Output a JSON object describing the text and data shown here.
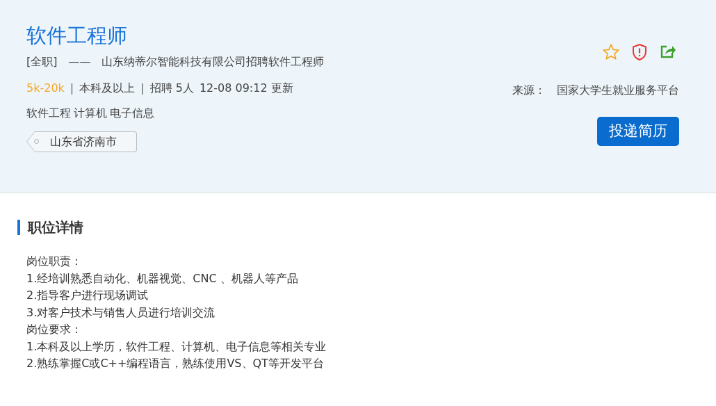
{
  "job": {
    "title": "软件工程师",
    "type": "[全职]",
    "dash": "——",
    "headline": "山东纳蒂尔智能科技有限公司招聘软件工程师",
    "meta": [
      {
        "kind": "salary",
        "text": "5k-20k"
      },
      {
        "kind": "divider",
        "text": "|"
      },
      {
        "kind": "plain",
        "text": "本科及以上"
      },
      {
        "kind": "divider",
        "text": "|"
      },
      {
        "kind": "plain",
        "text": "招聘 5人"
      },
      {
        "kind": "plain",
        "text": "12-08 09:12 更新"
      }
    ],
    "majors": [
      "软件工程",
      "计算机",
      "电子信息"
    ],
    "location": "山东省济南市"
  },
  "source": {
    "label": "来源：",
    "name": "国家大学生就业服务平台"
  },
  "apply_button": "投递简历",
  "details": {
    "heading": "职位详情",
    "lines": [
      "岗位职责：",
      "1.经培训熟悉自动化、机器视觉、CNC 、机器人等产品",
      "2.指导客户进行现场调试",
      "3.对客户技术与销售人员进行培训交流",
      "岗位要求：",
      "1.本科及以上学历，软件工程、计算机、电子信息等相关专业",
      "2.熟练掌握C或C++编程语言，熟练使用VS、QT等开发平台"
    ]
  }
}
